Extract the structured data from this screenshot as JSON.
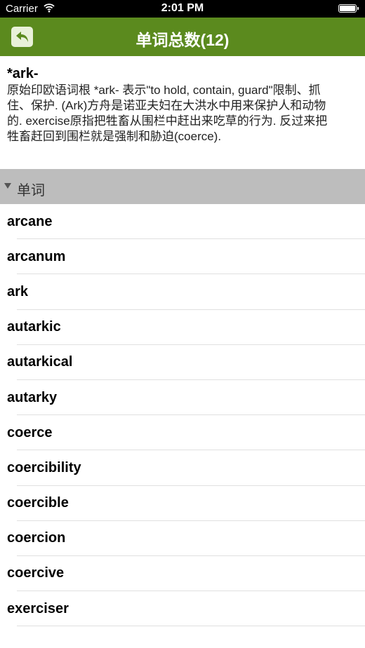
{
  "status_bar": {
    "carrier": "Carrier",
    "time": "2:01 PM"
  },
  "nav": {
    "title": "单词总数(12)"
  },
  "root": {
    "word": "*ark-",
    "description": "原始印欧语词根 *ark- 表示\"to hold, contain, guard\"限制、抓住、保护. (Ark)方舟是诺亚夫妇在大洪水中用来保护人和动物的. exercise原指把牲畜从围栏中赶出来吃草的行为. 反过来把牲畜赶回到围栏就是强制和胁迫(coerce)."
  },
  "section": {
    "label": "单词"
  },
  "words": [
    "arcane",
    "arcanum",
    "ark",
    "autarkic",
    "autarkical",
    "autarky",
    "coerce",
    "coercibility",
    "coercible",
    "coercion",
    "coercive",
    "exerciser"
  ],
  "colors": {
    "nav_bg": "#5b8a1e",
    "section_bg": "#bdbdbd",
    "back_button_bg": "#e9f1d9"
  }
}
